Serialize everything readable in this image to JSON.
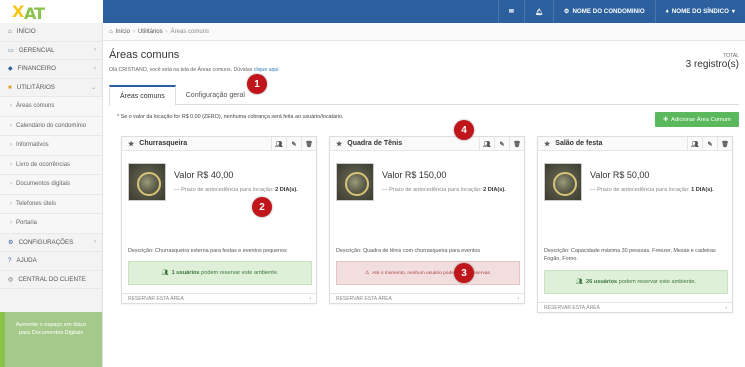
{
  "logo": {
    "text_a": "AT",
    "text_b": "X"
  },
  "topnav": {
    "condominio": "NOME DO CONDOMINIO",
    "sindico": "NOME DO SÍNDICO"
  },
  "sidebar": {
    "items": [
      {
        "label": "INÍCIO",
        "icon": "home-icon"
      },
      {
        "label": "GERENCIAL",
        "icon": "monitor-icon"
      },
      {
        "label": "FINANCEIRO",
        "icon": "tag-icon"
      },
      {
        "label": "UTILITÁRIOS",
        "icon": "briefcase-icon"
      }
    ],
    "sub": [
      "Áreas comuns",
      "Calendário do condomínio",
      "Informativos",
      "Livro de ocorrências",
      "Documentos digitais",
      "Telefones úteis",
      "Portaria"
    ],
    "bottom": [
      {
        "label": "CONFIGURAÇÕES",
        "icon": "gears-icon"
      },
      {
        "label": "AJUDA",
        "icon": "help-icon"
      },
      {
        "label": "CENTRAL DO CLIENTE",
        "icon": "globe-icon"
      }
    ],
    "promo": "Aumente o espaço em disco para Documentos Digitais"
  },
  "breadcrumb": [
    "Início",
    "Utilitários",
    "Áreas comuns"
  ],
  "page": {
    "title": "Áreas comuns",
    "welcome": "Olá CRISTIANO, você está na tela de Áreas comuns. Dúvidas",
    "welcome_link": "clique aqui",
    "total_label": "TOTAL",
    "total_value": "3 registro(s)"
  },
  "tabs": [
    "Áreas comuns",
    "Configuração geral"
  ],
  "note": "* Se o valor da locação for R$ 0,00 (ZERO), nenhuma cobrança será feita ao usuário/locatário.",
  "add_button": "Adicionar Área Comum",
  "cards": [
    {
      "name": "Churrasqueira",
      "price": "Valor R$ 40,00",
      "prazo_label": "— Prazo de antecedência para locação:",
      "prazo_value": "2 DIA(s).",
      "desc": "Descrição: Churrasqueira externa para festas e eventos pequenos",
      "alert_type": "ok",
      "alert_strong": "1 usuários",
      "alert_text": "podem reservar este ambiente.",
      "footer": "RESERVAR ESTA ÁREA"
    },
    {
      "name": "Quadra de Tênis",
      "price": "Valor R$ 150,00",
      "prazo_label": "— Prazo de antecedência para locação:",
      "prazo_value": "2 DIA(s).",
      "desc": "Descrição: Quadra de tênis com churrasqueira para eventos",
      "alert_type": "bad",
      "alert_strong": "",
      "alert_text": "Até o momento, nenhum usuário pode efetuar reservas.",
      "footer": "RESERVAR ESTA ÁREA"
    },
    {
      "name": "Salão de festa",
      "price": "Valor R$ 50,00",
      "prazo_label": "— Prazo de antecedência para locação:",
      "prazo_value": "1 DIA(s).",
      "desc": "Descrição: Capacidade máxima 30 pessoas. Freezer, Mesas e cadeiras Fogão, Forno.",
      "alert_type": "ok",
      "alert_strong": "26 usuários",
      "alert_text": "podem reservar este ambiente.",
      "footer": "RESERVAR ESTA ÁREA"
    }
  ],
  "badges": [
    "1",
    "2",
    "3",
    "4"
  ]
}
